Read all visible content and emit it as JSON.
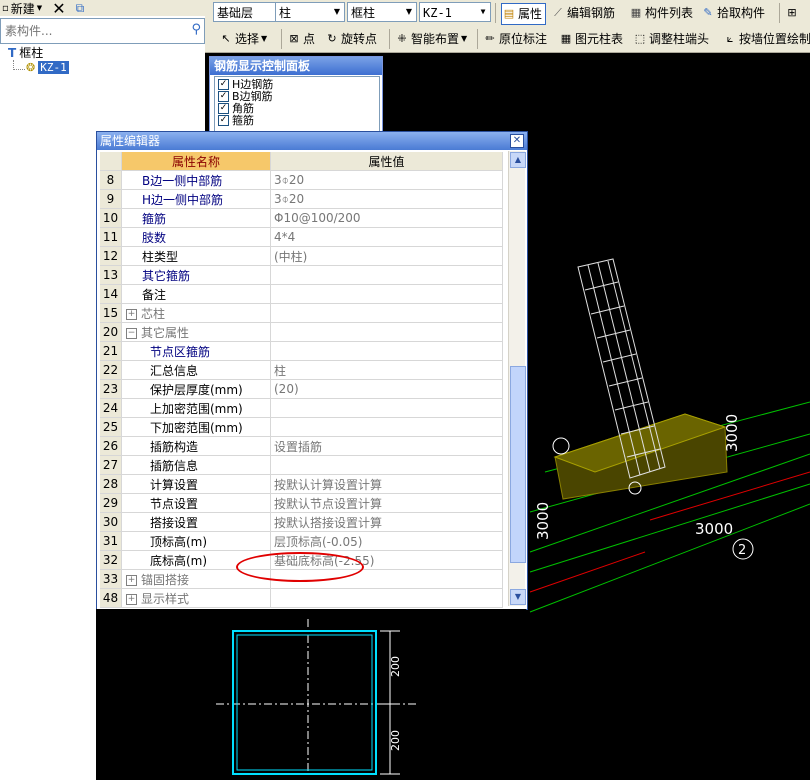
{
  "left_panel": {
    "new_label": "新建",
    "search_placeholder": "素构件...",
    "tree_root": "框柱",
    "tree_child": "KZ-1"
  },
  "toolbar1": {
    "floor": "基础层",
    "type": "柱",
    "subtype": "框柱",
    "component": "KZ-1",
    "attr_btn": "属性",
    "edit_rebar_btn": "编辑钢筋",
    "comp_list_btn": "构件列表",
    "pick_btn": "拾取构件"
  },
  "toolbar2": {
    "select_btn": "选择",
    "point_btn": "点",
    "rotate_btn": "旋转点",
    "smart_btn": "智能布置",
    "origin_btn": "原位标注",
    "table_btn": "图元柱表",
    "adjust_btn": "调整柱端头",
    "wallpos_btn": "按墙位置绘制"
  },
  "rebar_panel": {
    "title": "钢筋显示控制面板",
    "items": [
      "H边钢筋",
      "B边钢筋",
      "角筋",
      "箍筋"
    ]
  },
  "property_editor": {
    "title": "属性编辑器",
    "col_name": "属性名称",
    "col_value": "属性值",
    "rows": [
      {
        "num": "8",
        "name": "B边一侧中部筋",
        "value": "3⌽20"
      },
      {
        "num": "9",
        "name": "H边一侧中部筋",
        "value": "3⌽20"
      },
      {
        "num": "10",
        "name": "箍筋",
        "value": "Φ10@100/200"
      },
      {
        "num": "11",
        "name": "肢数",
        "value": "4*4"
      },
      {
        "num": "12",
        "name": "柱类型",
        "value": "(中柱)"
      },
      {
        "num": "13",
        "name": "其它箍筋",
        "value": ""
      },
      {
        "num": "14",
        "name": "备注",
        "value": ""
      },
      {
        "num": "15",
        "name": "芯柱",
        "value": ""
      },
      {
        "num": "20",
        "name": "其它属性",
        "value": ""
      },
      {
        "num": "21",
        "name": "节点区箍筋",
        "value": ""
      },
      {
        "num": "22",
        "name": "汇总信息",
        "value": "柱"
      },
      {
        "num": "23",
        "name": "保护层厚度(mm)",
        "value": "(20)"
      },
      {
        "num": "24",
        "name": "上加密范围(mm)",
        "value": ""
      },
      {
        "num": "25",
        "name": "下加密范围(mm)",
        "value": ""
      },
      {
        "num": "26",
        "name": "插筋构造",
        "value": "设置插筋"
      },
      {
        "num": "27",
        "name": "插筋信息",
        "value": ""
      },
      {
        "num": "28",
        "name": "计算设置",
        "value": "按默认计算设置计算"
      },
      {
        "num": "29",
        "name": "节点设置",
        "value": "按默认节点设置计算"
      },
      {
        "num": "30",
        "name": "搭接设置",
        "value": "按默认搭接设置计算"
      },
      {
        "num": "31",
        "name": "顶标高(m)",
        "value": "层顶标高(-0.05)"
      },
      {
        "num": "32",
        "name": "底标高(m)",
        "value": "基础底标高(-2.55)"
      },
      {
        "num": "33",
        "name": "锚固搭接",
        "value": ""
      },
      {
        "num": "48",
        "name": "显示样式",
        "value": ""
      }
    ]
  },
  "preview": {
    "dim_top": "200",
    "dim_bottom": "200"
  },
  "viewport": {
    "dim_left": "3000",
    "dim_mid": "3000",
    "dim_right": "3000",
    "axis_label": "2"
  },
  "colors": {
    "accent": "#316ac5",
    "highlight": "#e00000"
  }
}
